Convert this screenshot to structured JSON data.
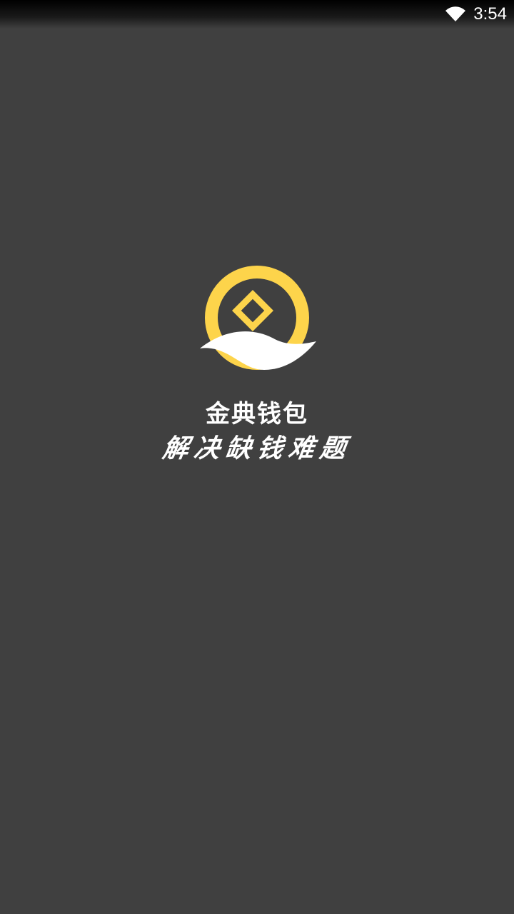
{
  "status_bar": {
    "time": "3:54",
    "wifi_icon": "wifi-icon"
  },
  "splash": {
    "logo_icon": "coin-wave-logo-icon",
    "app_name": "金典钱包",
    "slogan": "解决缺钱难题"
  },
  "colors": {
    "background": "#404040",
    "logo_gold": "#FDD44B",
    "logo_wave": "#FFFFFF",
    "text": "#FFFFFF"
  }
}
